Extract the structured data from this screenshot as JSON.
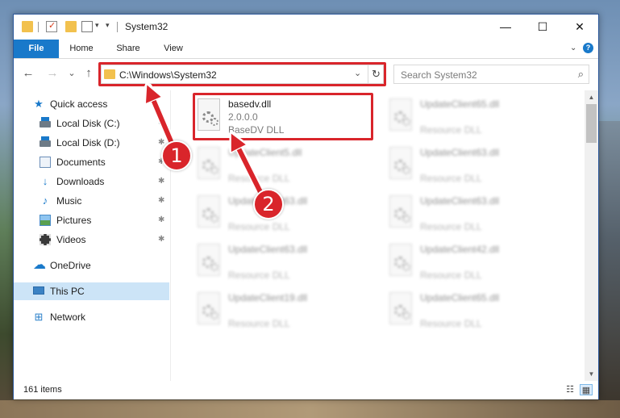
{
  "window": {
    "title": "System32"
  },
  "window_controls": {
    "minimize": "—",
    "maximize": "☐",
    "close": "✕"
  },
  "ribbon": {
    "tabs": [
      {
        "label": "File"
      },
      {
        "label": "Home"
      },
      {
        "label": "Share"
      },
      {
        "label": "View"
      }
    ],
    "expand": "⌄",
    "help": "?"
  },
  "nav": {
    "back": "←",
    "forward": "→",
    "recent": "⌄",
    "up": "↑",
    "address": "C:\\Windows\\System32",
    "address_dropdown": "⌄",
    "refresh": "↻",
    "search_placeholder": "Search System32",
    "search_glyph": "⌕"
  },
  "sidebar": {
    "items": [
      {
        "label": "Quick access",
        "icon": "star-icon",
        "glyph": "★",
        "pinned": false
      },
      {
        "label": "Local Disk (C:)",
        "icon": "drive-icon",
        "glyph": "",
        "pinned": true
      },
      {
        "label": "Local Disk (D:)",
        "icon": "drive-icon",
        "glyph": "",
        "pinned": true
      },
      {
        "label": "Documents",
        "icon": "documents-icon",
        "glyph": "",
        "pinned": true
      },
      {
        "label": "Downloads",
        "icon": "download-icon",
        "glyph": "↓",
        "pinned": true
      },
      {
        "label": "Music",
        "icon": "music-icon",
        "glyph": "♪",
        "pinned": true
      },
      {
        "label": "Pictures",
        "icon": "pictures-icon",
        "glyph": "",
        "pinned": true
      },
      {
        "label": "Videos",
        "icon": "videos-icon",
        "glyph": "",
        "pinned": true
      },
      {
        "label": "OneDrive",
        "icon": "onedrive-icon",
        "glyph": "☁",
        "pinned": false
      },
      {
        "label": "This PC",
        "icon": "this-pc-icon",
        "glyph": "",
        "pinned": false,
        "selected": true
      },
      {
        "label": "Network",
        "icon": "network-icon",
        "glyph": "⊞",
        "pinned": false
      }
    ],
    "pin_glyph": "📌"
  },
  "files": [
    {
      "name": "basedv.dll",
      "version": "2.0.0.0",
      "description": "BaseDV DLL",
      "highlighted": true
    },
    {
      "name": "UpdateClient65.dll",
      "version": "",
      "description": "Resource DLL"
    },
    {
      "name": "UpdateClient5.dll",
      "version": "",
      "description": "Resource DLL"
    },
    {
      "name": "UpdateClient63.dll",
      "version": "",
      "description": "Resource DLL"
    },
    {
      "name": "UpdateClient63.dll",
      "version": "",
      "description": "Resource DLL"
    },
    {
      "name": "UpdateClient63.dll",
      "version": "",
      "description": "Resource DLL"
    },
    {
      "name": "UpdateClient63.dll",
      "version": "",
      "description": "Resource DLL"
    },
    {
      "name": "UpdateClient42.dll",
      "version": "",
      "description": "Resource DLL"
    },
    {
      "name": "UpdateClient19.dll",
      "version": "",
      "description": "Resource DLL"
    },
    {
      "name": "UpdateClient65.dll",
      "version": "",
      "description": "Resource DLL"
    }
  ],
  "scrollbar": {
    "up": "▲",
    "down": "▼"
  },
  "status": {
    "item_count": "161 items"
  },
  "view_buttons": {
    "details": "☷",
    "tiles": "▦"
  },
  "annotations": {
    "step1": "1",
    "step2": "2"
  },
  "colors": {
    "accent": "#1979ca",
    "highlight": "#d9252b",
    "selection": "#cce4f7"
  }
}
